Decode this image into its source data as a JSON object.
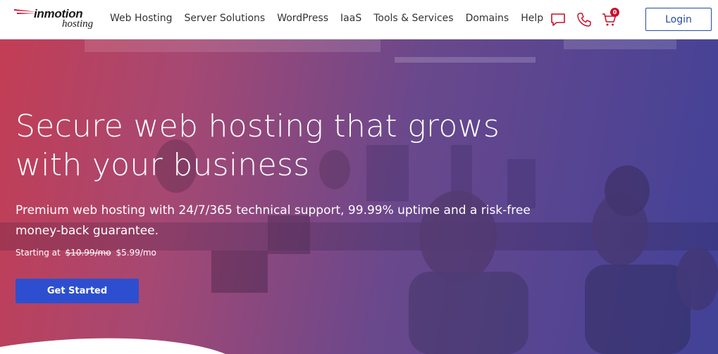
{
  "logo": {
    "main": "inmotion",
    "sub": "hosting"
  },
  "nav": {
    "items": [
      {
        "label": "Web Hosting"
      },
      {
        "label": "Server Solutions"
      },
      {
        "label": "WordPress"
      },
      {
        "label": "IaaS"
      },
      {
        "label": "Tools & Services"
      },
      {
        "label": "Domains"
      },
      {
        "label": "Help"
      }
    ]
  },
  "header": {
    "chat_icon": "chat-bubble-icon",
    "phone_icon": "phone-icon",
    "cart_icon": "cart-icon",
    "cart_count": "0",
    "login_label": "Login"
  },
  "hero": {
    "headline": "Secure web hosting that grows with your business",
    "subhead": "Premium web hosting with 24/7/365 technical support, 99.99% uptime and a risk-free money-back guarantee.",
    "starting_label": "Starting at",
    "old_price": "$10.99/mo",
    "new_price": "$5.99/mo",
    "cta_label": "Get Started"
  },
  "colors": {
    "accent_red": "#c8102e",
    "brand_blue": "#2a4b9e",
    "cta_blue": "#2d4fcf"
  }
}
